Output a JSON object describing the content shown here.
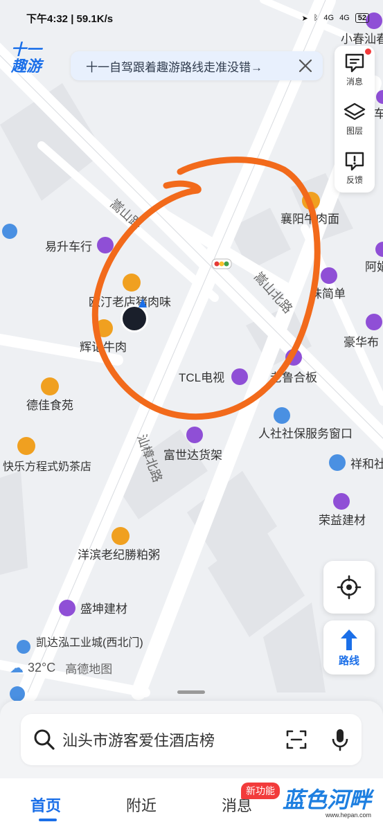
{
  "status_bar": {
    "time_speed": "下午4:32 | 59.1K/s",
    "signal1": "4G",
    "signal2": "4G",
    "battery": "52"
  },
  "logo": {
    "line1": "十一",
    "line2": "趣游"
  },
  "banner": {
    "text": "十一自驾跟着趣游路线走准没错→"
  },
  "tools": {
    "messages": "消息",
    "layers": "图层",
    "feedback": "反馈"
  },
  "map": {
    "roads": [
      "嵩山路",
      "嵩山北路",
      "汕樟北路"
    ],
    "pois": [
      {
        "name": "小春汕春",
        "icon": "shop-icon",
        "color": "#8f4fd6"
      },
      {
        "name": "易升车行",
        "icon": "shop-icon",
        "color": "#8f4fd6"
      },
      {
        "name": "襄阳牛肉面",
        "icon": "food-icon",
        "color": "#f0a020"
      },
      {
        "name": "阿娟",
        "icon": "shop-icon",
        "color": "#8f4fd6"
      },
      {
        "name": "欧汀老店猪肉味",
        "icon": "food-icon",
        "color": "#f0a020"
      },
      {
        "name": "味简单",
        "icon": "shop-icon",
        "color": "#8f4fd6"
      },
      {
        "name": "辉记牛肉",
        "icon": "food-icon",
        "color": "#f0a020"
      },
      {
        "name": "豪华布",
        "icon": "shop-icon",
        "color": "#8f4fd6"
      },
      {
        "name": "TCL电视",
        "icon": "shop-icon",
        "color": "#8f4fd6"
      },
      {
        "name": "老鲁合板",
        "icon": "shop-icon",
        "color": "#8f4fd6"
      },
      {
        "name": "德佳食苑",
        "icon": "food-icon",
        "color": "#f0a020"
      },
      {
        "name": "人社社保服务窗口",
        "icon": "pin-icon",
        "color": "#4a90e2"
      },
      {
        "name": "富世达货架",
        "icon": "shop-icon",
        "color": "#8f4fd6"
      },
      {
        "name": "快乐方程式奶茶店",
        "icon": "drink-icon",
        "color": "#f0a020"
      },
      {
        "name": "祥和社",
        "icon": "police-icon",
        "color": "#4a90e2"
      },
      {
        "name": "荣益建材",
        "icon": "shop-icon",
        "color": "#8f4fd6"
      },
      {
        "name": "洋滨老纪勝粕粥",
        "icon": "food-icon",
        "color": "#f0a020"
      },
      {
        "name": "盛坤建材",
        "icon": "shop-icon",
        "color": "#8f4fd6"
      },
      {
        "name": "凯达泓工业城(西北门)",
        "icon": "gate-icon",
        "color": "#4a90e2"
      },
      {
        "name": "车维",
        "icon": "shop-icon",
        "color": "#8f4fd6"
      }
    ],
    "annotation_color": "#f26a1b"
  },
  "weather": {
    "temp": "32°C",
    "brand": "高德地图"
  },
  "route_button": {
    "label": "路线"
  },
  "search": {
    "placeholder": "汕头市游客爱住酒店榜"
  },
  "tabs": [
    {
      "label": "首页",
      "active": true
    },
    {
      "label": "附近",
      "active": false
    },
    {
      "label": "消息",
      "active": false
    }
  ],
  "new_badge": "新功能",
  "watermark": {
    "main": "蓝色河畔",
    "sub": "www.hepan.com"
  }
}
